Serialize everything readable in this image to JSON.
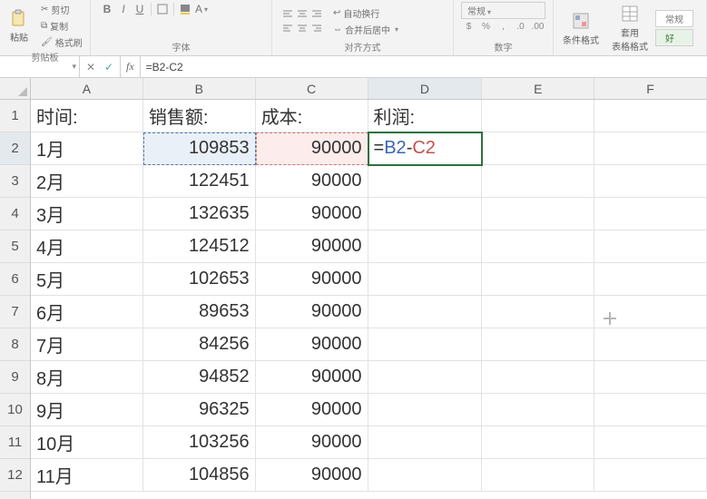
{
  "ribbon": {
    "clipboard": {
      "label": "剪贴板",
      "paste": "粘贴",
      "cut": "剪切",
      "copy": "复制",
      "format_painter": "格式刷"
    },
    "font": {
      "label": "字体"
    },
    "alignment": {
      "label": "对齐方式",
      "wrap": "自动换行",
      "merge": "合并后居中"
    },
    "number_group": {
      "label": "数字",
      "general": "常规"
    },
    "styles": {
      "conditional": "条件格式",
      "table": "套用\n表格格式",
      "normal": "常规",
      "good": "好"
    }
  },
  "name_box": "",
  "fx_label": "fx",
  "formula_bar": "=B2-C2",
  "columns": [
    "A",
    "B",
    "C",
    "D",
    "E",
    "F"
  ],
  "row_count": 12,
  "headers": {
    "time": "时间:",
    "sales": "销售额:",
    "cost": "成本:",
    "profit": "利润:"
  },
  "active_formula": {
    "eq": "=",
    "ref1": "B2",
    "op": "-",
    "ref2": "C2"
  },
  "data_rows": [
    {
      "month": "1月",
      "sales": "109853",
      "cost": "90000"
    },
    {
      "month": "2月",
      "sales": "122451",
      "cost": "90000"
    },
    {
      "month": "3月",
      "sales": "132635",
      "cost": "90000"
    },
    {
      "month": "4月",
      "sales": "124512",
      "cost": "90000"
    },
    {
      "month": "5月",
      "sales": "102653",
      "cost": "90000"
    },
    {
      "month": "6月",
      "sales": "89653",
      "cost": "90000"
    },
    {
      "month": "7月",
      "sales": "84256",
      "cost": "90000"
    },
    {
      "month": "8月",
      "sales": "94852",
      "cost": "90000"
    },
    {
      "month": "9月",
      "sales": "96325",
      "cost": "90000"
    },
    {
      "month": "10月",
      "sales": "103256",
      "cost": "90000"
    },
    {
      "month": "11月",
      "sales": "104856",
      "cost": "90000"
    }
  ],
  "chart_data": {
    "type": "table",
    "title": "",
    "columns": [
      "时间",
      "销售额",
      "成本",
      "利润"
    ],
    "rows": [
      [
        "1月",
        109853,
        90000,
        null
      ],
      [
        "2月",
        122451,
        90000,
        null
      ],
      [
        "3月",
        132635,
        90000,
        null
      ],
      [
        "4月",
        124512,
        90000,
        null
      ],
      [
        "5月",
        102653,
        90000,
        null
      ],
      [
        "6月",
        89653,
        90000,
        null
      ],
      [
        "7月",
        84256,
        90000,
        null
      ],
      [
        "8月",
        94852,
        90000,
        null
      ],
      [
        "9月",
        96325,
        90000,
        null
      ],
      [
        "10月",
        103256,
        90000,
        null
      ],
      [
        "11月",
        104856,
        90000,
        null
      ]
    ]
  }
}
